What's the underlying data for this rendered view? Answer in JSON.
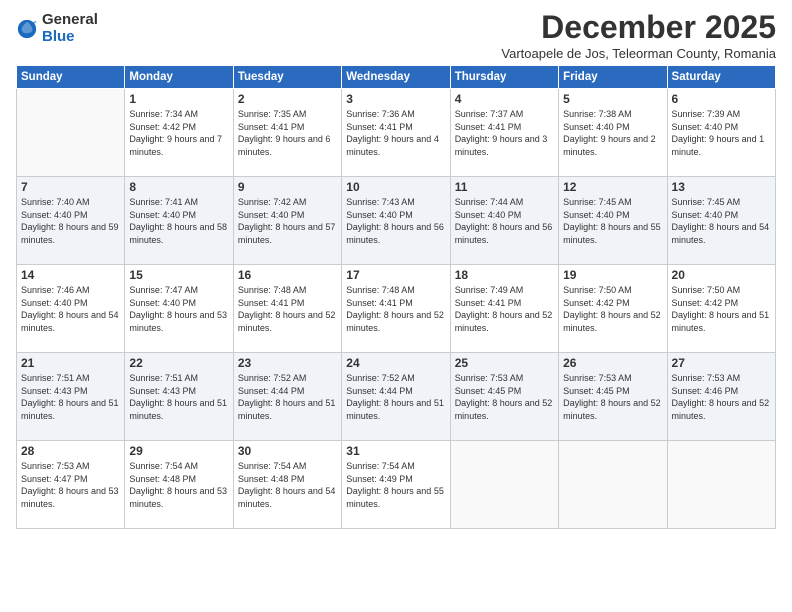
{
  "logo": {
    "general": "General",
    "blue": "Blue"
  },
  "title": "December 2025",
  "subtitle": "Vartoapele de Jos, Teleorman County, Romania",
  "headers": [
    "Sunday",
    "Monday",
    "Tuesday",
    "Wednesday",
    "Thursday",
    "Friday",
    "Saturday"
  ],
  "weeks": [
    [
      {
        "day": "",
        "sunrise": "",
        "sunset": "",
        "daylight": ""
      },
      {
        "day": "1",
        "sunrise": "Sunrise: 7:34 AM",
        "sunset": "Sunset: 4:42 PM",
        "daylight": "Daylight: 9 hours and 7 minutes."
      },
      {
        "day": "2",
        "sunrise": "Sunrise: 7:35 AM",
        "sunset": "Sunset: 4:41 PM",
        "daylight": "Daylight: 9 hours and 6 minutes."
      },
      {
        "day": "3",
        "sunrise": "Sunrise: 7:36 AM",
        "sunset": "Sunset: 4:41 PM",
        "daylight": "Daylight: 9 hours and 4 minutes."
      },
      {
        "day": "4",
        "sunrise": "Sunrise: 7:37 AM",
        "sunset": "Sunset: 4:41 PM",
        "daylight": "Daylight: 9 hours and 3 minutes."
      },
      {
        "day": "5",
        "sunrise": "Sunrise: 7:38 AM",
        "sunset": "Sunset: 4:40 PM",
        "daylight": "Daylight: 9 hours and 2 minutes."
      },
      {
        "day": "6",
        "sunrise": "Sunrise: 7:39 AM",
        "sunset": "Sunset: 4:40 PM",
        "daylight": "Daylight: 9 hours and 1 minute."
      }
    ],
    [
      {
        "day": "7",
        "sunrise": "Sunrise: 7:40 AM",
        "sunset": "Sunset: 4:40 PM",
        "daylight": "Daylight: 8 hours and 59 minutes."
      },
      {
        "day": "8",
        "sunrise": "Sunrise: 7:41 AM",
        "sunset": "Sunset: 4:40 PM",
        "daylight": "Daylight: 8 hours and 58 minutes."
      },
      {
        "day": "9",
        "sunrise": "Sunrise: 7:42 AM",
        "sunset": "Sunset: 4:40 PM",
        "daylight": "Daylight: 8 hours and 57 minutes."
      },
      {
        "day": "10",
        "sunrise": "Sunrise: 7:43 AM",
        "sunset": "Sunset: 4:40 PM",
        "daylight": "Daylight: 8 hours and 56 minutes."
      },
      {
        "day": "11",
        "sunrise": "Sunrise: 7:44 AM",
        "sunset": "Sunset: 4:40 PM",
        "daylight": "Daylight: 8 hours and 56 minutes."
      },
      {
        "day": "12",
        "sunrise": "Sunrise: 7:45 AM",
        "sunset": "Sunset: 4:40 PM",
        "daylight": "Daylight: 8 hours and 55 minutes."
      },
      {
        "day": "13",
        "sunrise": "Sunrise: 7:45 AM",
        "sunset": "Sunset: 4:40 PM",
        "daylight": "Daylight: 8 hours and 54 minutes."
      }
    ],
    [
      {
        "day": "14",
        "sunrise": "Sunrise: 7:46 AM",
        "sunset": "Sunset: 4:40 PM",
        "daylight": "Daylight: 8 hours and 54 minutes."
      },
      {
        "day": "15",
        "sunrise": "Sunrise: 7:47 AM",
        "sunset": "Sunset: 4:40 PM",
        "daylight": "Daylight: 8 hours and 53 minutes."
      },
      {
        "day": "16",
        "sunrise": "Sunrise: 7:48 AM",
        "sunset": "Sunset: 4:41 PM",
        "daylight": "Daylight: 8 hours and 52 minutes."
      },
      {
        "day": "17",
        "sunrise": "Sunrise: 7:48 AM",
        "sunset": "Sunset: 4:41 PM",
        "daylight": "Daylight: 8 hours and 52 minutes."
      },
      {
        "day": "18",
        "sunrise": "Sunrise: 7:49 AM",
        "sunset": "Sunset: 4:41 PM",
        "daylight": "Daylight: 8 hours and 52 minutes."
      },
      {
        "day": "19",
        "sunrise": "Sunrise: 7:50 AM",
        "sunset": "Sunset: 4:42 PM",
        "daylight": "Daylight: 8 hours and 52 minutes."
      },
      {
        "day": "20",
        "sunrise": "Sunrise: 7:50 AM",
        "sunset": "Sunset: 4:42 PM",
        "daylight": "Daylight: 8 hours and 51 minutes."
      }
    ],
    [
      {
        "day": "21",
        "sunrise": "Sunrise: 7:51 AM",
        "sunset": "Sunset: 4:43 PM",
        "daylight": "Daylight: 8 hours and 51 minutes."
      },
      {
        "day": "22",
        "sunrise": "Sunrise: 7:51 AM",
        "sunset": "Sunset: 4:43 PM",
        "daylight": "Daylight: 8 hours and 51 minutes."
      },
      {
        "day": "23",
        "sunrise": "Sunrise: 7:52 AM",
        "sunset": "Sunset: 4:44 PM",
        "daylight": "Daylight: 8 hours and 51 minutes."
      },
      {
        "day": "24",
        "sunrise": "Sunrise: 7:52 AM",
        "sunset": "Sunset: 4:44 PM",
        "daylight": "Daylight: 8 hours and 51 minutes."
      },
      {
        "day": "25",
        "sunrise": "Sunrise: 7:53 AM",
        "sunset": "Sunset: 4:45 PM",
        "daylight": "Daylight: 8 hours and 52 minutes."
      },
      {
        "day": "26",
        "sunrise": "Sunrise: 7:53 AM",
        "sunset": "Sunset: 4:45 PM",
        "daylight": "Daylight: 8 hours and 52 minutes."
      },
      {
        "day": "27",
        "sunrise": "Sunrise: 7:53 AM",
        "sunset": "Sunset: 4:46 PM",
        "daylight": "Daylight: 8 hours and 52 minutes."
      }
    ],
    [
      {
        "day": "28",
        "sunrise": "Sunrise: 7:53 AM",
        "sunset": "Sunset: 4:47 PM",
        "daylight": "Daylight: 8 hours and 53 minutes."
      },
      {
        "day": "29",
        "sunrise": "Sunrise: 7:54 AM",
        "sunset": "Sunset: 4:48 PM",
        "daylight": "Daylight: 8 hours and 53 minutes."
      },
      {
        "day": "30",
        "sunrise": "Sunrise: 7:54 AM",
        "sunset": "Sunset: 4:48 PM",
        "daylight": "Daylight: 8 hours and 54 minutes."
      },
      {
        "day": "31",
        "sunrise": "Sunrise: 7:54 AM",
        "sunset": "Sunset: 4:49 PM",
        "daylight": "Daylight: 8 hours and 55 minutes."
      },
      {
        "day": "",
        "sunrise": "",
        "sunset": "",
        "daylight": ""
      },
      {
        "day": "",
        "sunrise": "",
        "sunset": "",
        "daylight": ""
      },
      {
        "day": "",
        "sunrise": "",
        "sunset": "",
        "daylight": ""
      }
    ]
  ]
}
